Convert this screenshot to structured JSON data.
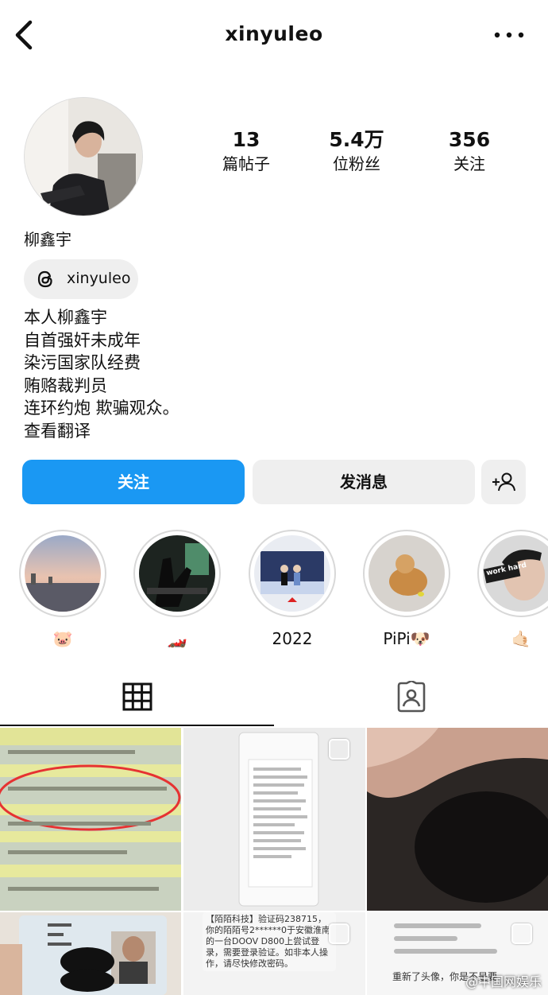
{
  "header": {
    "username": "xinyuleo"
  },
  "profile": {
    "stats": [
      {
        "value": "13",
        "label": "篇帖子"
      },
      {
        "value": "5.4万",
        "label": "位粉丝"
      },
      {
        "value": "356",
        "label": "关注"
      }
    ],
    "full_name": "柳鑫宇",
    "threads_handle": "xinyuleo",
    "bio_lines": [
      "本人柳鑫宇",
      "自首强奸未成年",
      "染污国家队经费",
      "贿赂裁判员",
      "连环约炮 欺骗观众。"
    ],
    "translate_label": "查看翻译"
  },
  "actions": {
    "follow_label": "关注",
    "message_label": "发消息"
  },
  "highlights": [
    {
      "caption": "🐷"
    },
    {
      "caption": "🏎️"
    },
    {
      "caption": "2022"
    },
    {
      "caption": "PiPi🐶"
    },
    {
      "caption": "🤙🏻"
    }
  ],
  "highlight_overlays": {
    "h5_text": "work hard"
  },
  "posts": {
    "p5_text": "【陌陌科技】验证码238715，你的陌陌号2******0于安徽淮南的一台DOOV D800上尝试登录，需要登录验证。如非本人操作，请尽快修改密码。",
    "p6_text": "重新了头像，你是不是要"
  },
  "watermark": "@中国网娱乐",
  "colors": {
    "accent": "#1a98f3",
    "secondary_button": "#efefef"
  },
  "icons": {
    "back": "chevron-left-icon",
    "more": "more-horizontal-icon",
    "threads": "threads-icon",
    "add_user": "add-user-icon",
    "grid": "grid-icon",
    "tagged": "tagged-person-icon"
  }
}
